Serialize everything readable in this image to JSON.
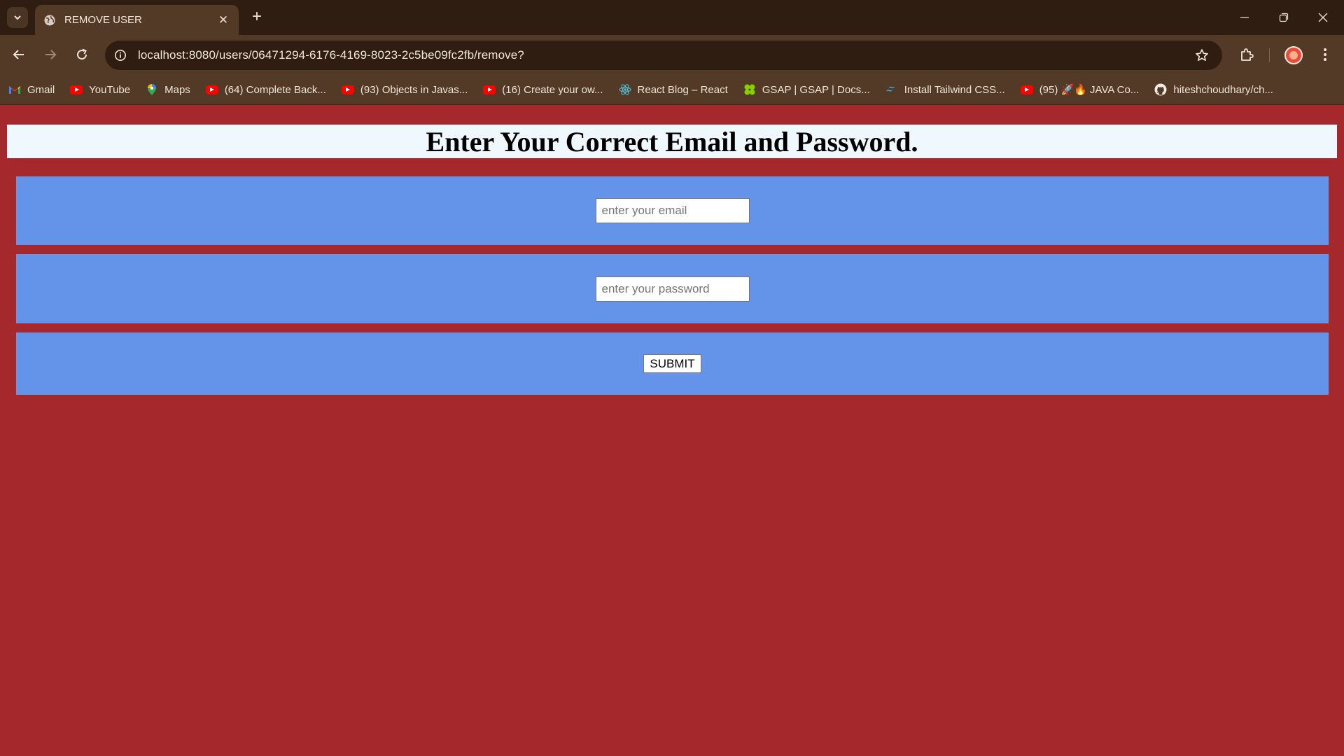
{
  "browser": {
    "tab_title": "REMOVE USER",
    "tab_close": "✕",
    "new_tab": "+",
    "url": "localhost:8080/users/06471294-6176-4169-8023-2c5be09fc2fb/remove?",
    "accent": "#533a27",
    "bookmarks": [
      {
        "label": "Gmail",
        "icon": "gmail-icon"
      },
      {
        "label": "YouTube",
        "icon": "youtube-icon"
      },
      {
        "label": "Maps",
        "icon": "maps-icon"
      },
      {
        "label": "(64) Complete Back...",
        "icon": "youtube-icon"
      },
      {
        "label": "(93) Objects in Javas...",
        "icon": "youtube-icon"
      },
      {
        "label": "(16) Create your ow...",
        "icon": "youtube-icon"
      },
      {
        "label": "React Blog – React",
        "icon": "react-icon"
      },
      {
        "label": "GSAP | GSAP | Docs...",
        "icon": "gsap-icon"
      },
      {
        "label": "Install Tailwind CSS...",
        "icon": "tailwind-icon"
      },
      {
        "label": "(95) 🚀🔥 JAVA Co...",
        "icon": "youtube-icon"
      },
      {
        "label": "hiteshchoudhary/ch...",
        "icon": "github-icon"
      }
    ]
  },
  "page": {
    "heading": "Enter Your Correct Email and Password.",
    "email_placeholder": "enter your email",
    "email_value": "",
    "password_placeholder": "enter your password",
    "password_value": "",
    "submit_label": "SUBMIT",
    "background_color": "#a5292c",
    "row_color": "#6493ea",
    "heading_bg": "#f0f8ff"
  }
}
